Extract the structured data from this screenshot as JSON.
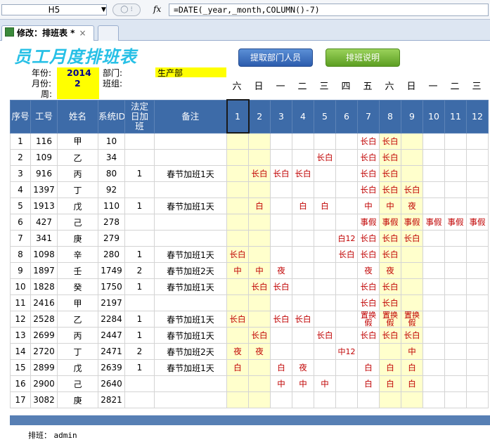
{
  "formula_bar": {
    "name_box": "H5",
    "fx": "fx",
    "formula": "=DATE(_year,_month,COLUMN()-7)"
  },
  "tab": {
    "label": "修改：排班表 *",
    "close": "×"
  },
  "page": {
    "title": "员工月度排班表"
  },
  "buttons": {
    "fetch": "提取部门人员",
    "explain": "排班说明"
  },
  "info": {
    "year_label": "年份:",
    "year": "2014",
    "month_label": "月份:",
    "month": "2",
    "week_label": "周:",
    "dept_label": "部门:",
    "dept": "生产部",
    "group_label": "班组:"
  },
  "weekdays": [
    "六",
    "日",
    "一",
    "二",
    "三",
    "四",
    "五",
    "六",
    "日",
    "一",
    "二",
    "三"
  ],
  "colors": {
    "header_bg": "#3d6ba8",
    "title": "#27c0e6",
    "shift_text": "#c00000",
    "highlight": "#ffff00"
  },
  "table": {
    "headers": [
      "序号",
      "工号",
      "姓名",
      "系统ID",
      "法定日加班",
      "备注"
    ],
    "days": [
      "1",
      "2",
      "3",
      "4",
      "5",
      "6",
      "7",
      "8",
      "9",
      "10",
      "11",
      "12"
    ],
    "rows": [
      {
        "no": "1",
        "emp_id": "116",
        "name": "甲",
        "sys_id": "10",
        "ot": "",
        "note": "",
        "days": [
          "",
          "",
          "",
          "",
          "",
          "",
          "长白",
          "长白",
          "",
          "",
          "",
          ""
        ]
      },
      {
        "no": "2",
        "emp_id": "109",
        "name": "乙",
        "sys_id": "34",
        "ot": "",
        "note": "",
        "days": [
          "",
          "",
          "",
          "",
          "长白",
          "",
          "长白",
          "长白",
          "",
          "",
          "",
          ""
        ]
      },
      {
        "no": "3",
        "emp_id": "916",
        "name": "丙",
        "sys_id": "80",
        "ot": "1",
        "note": "春节加班1天",
        "days": [
          "",
          "长白",
          "长白",
          "长白",
          "",
          "",
          "长白",
          "长白",
          "",
          "",
          "",
          ""
        ]
      },
      {
        "no": "4",
        "emp_id": "1397",
        "name": "丁",
        "sys_id": "92",
        "ot": "",
        "note": "",
        "days": [
          "",
          "",
          "",
          "",
          "",
          "",
          "长白",
          "长白",
          "长白",
          "",
          "",
          ""
        ]
      },
      {
        "no": "5",
        "emp_id": "1913",
        "name": "戊",
        "sys_id": "110",
        "ot": "1",
        "note": "春节加班1天",
        "days": [
          "",
          "白",
          "",
          "白",
          "白",
          "",
          "中",
          "中",
          "夜",
          "",
          "",
          ""
        ]
      },
      {
        "no": "6",
        "emp_id": "427",
        "name": "己",
        "sys_id": "278",
        "ot": "",
        "note": "",
        "days": [
          "",
          "",
          "",
          "",
          "",
          "",
          "事假",
          "事假",
          "事假",
          "事假",
          "事假",
          "事假"
        ]
      },
      {
        "no": "7",
        "emp_id": "341",
        "name": "庚",
        "sys_id": "279",
        "ot": "",
        "note": "",
        "days": [
          "",
          "",
          "",
          "",
          "",
          "白12",
          "长白",
          "长白",
          "长白",
          "",
          "",
          ""
        ]
      },
      {
        "no": "8",
        "emp_id": "1098",
        "name": "辛",
        "sys_id": "280",
        "ot": "1",
        "note": "春节加班1天",
        "days": [
          "长白",
          "",
          "",
          "",
          "",
          "长白",
          "长白",
          "长白",
          "",
          "",
          "",
          ""
        ]
      },
      {
        "no": "9",
        "emp_id": "1897",
        "name": "壬",
        "sys_id": "1749",
        "ot": "2",
        "note": "春节加班2天",
        "days": [
          "中",
          "中",
          "夜",
          "",
          "",
          "",
          "夜",
          "夜",
          "",
          "",
          "",
          ""
        ]
      },
      {
        "no": "10",
        "emp_id": "1828",
        "name": "癸",
        "sys_id": "1750",
        "ot": "1",
        "note": "春节加班1天",
        "days": [
          "",
          "长白",
          "长白",
          "",
          "",
          "",
          "长白",
          "长白",
          "",
          "",
          "",
          ""
        ]
      },
      {
        "no": "11",
        "emp_id": "2416",
        "name": "甲",
        "sys_id": "2197",
        "ot": "",
        "note": "",
        "days": [
          "",
          "",
          "",
          "",
          "",
          "",
          "长白",
          "长白",
          "",
          "",
          "",
          ""
        ]
      },
      {
        "no": "12",
        "emp_id": "2528",
        "name": "乙",
        "sys_id": "2284",
        "ot": "1",
        "note": "春节加班1天",
        "days": [
          "长白",
          "",
          "长白",
          "长白",
          "",
          "",
          "置换假",
          "置换假",
          "置换假",
          "",
          "",
          ""
        ]
      },
      {
        "no": "13",
        "emp_id": "2699",
        "name": "丙",
        "sys_id": "2447",
        "ot": "1",
        "note": "春节加班1天",
        "days": [
          "",
          "长白",
          "",
          "",
          "长白",
          "",
          "长白",
          "长白",
          "长白",
          "",
          "",
          ""
        ]
      },
      {
        "no": "14",
        "emp_id": "2720",
        "name": "丁",
        "sys_id": "2471",
        "ot": "2",
        "note": "春节加班2天",
        "days": [
          "夜",
          "夜",
          "",
          "",
          "",
          "中12",
          "",
          "",
          "中",
          "",
          "",
          ""
        ]
      },
      {
        "no": "15",
        "emp_id": "2899",
        "name": "戊",
        "sys_id": "2639",
        "ot": "1",
        "note": "春节加班1天",
        "days": [
          "白",
          "",
          "白",
          "夜",
          "",
          "",
          "白",
          "白",
          "白",
          "",
          "",
          ""
        ]
      },
      {
        "no": "16",
        "emp_id": "2900",
        "name": "己",
        "sys_id": "2640",
        "ot": "",
        "note": "",
        "days": [
          "",
          "",
          "中",
          "中",
          "中",
          "",
          "白",
          "白",
          "白",
          "",
          "",
          ""
        ]
      },
      {
        "no": "17",
        "emp_id": "3082",
        "name": "庚",
        "sys_id": "2821",
        "ot": "",
        "note": "",
        "days": [
          "",
          "",
          "",
          "",
          "",
          "",
          "",
          "",
          "",
          "",
          "",
          ""
        ]
      }
    ]
  },
  "footer": {
    "label": "排班：",
    "user": "admin"
  }
}
